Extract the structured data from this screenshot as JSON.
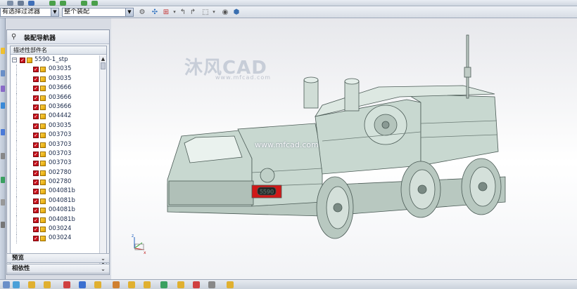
{
  "toolbar": {
    "filter_value": "有选择过滤器",
    "scope_value": "整个装配"
  },
  "navigator": {
    "title": "装配导航器",
    "column_header": "描述性部件名",
    "root_label": "5590-1_stp",
    "items": [
      "003035",
      "003035",
      "003666",
      "003666",
      "003666",
      "004442",
      "003035",
      "003703",
      "003703",
      "003703",
      "003703",
      "002780",
      "002780",
      "004081b",
      "004081b",
      "004081b",
      "004081b",
      "003024",
      "003024"
    ],
    "preview_label": "预览",
    "dependency_label": "相依性"
  },
  "viewport": {
    "watermark_text": "沐风CAD",
    "watermark_url": "www.mfcad.com",
    "watermark_center": "www.mfcad.com",
    "plate_text": "5590"
  },
  "colors": {
    "checkbox": "#c8101a",
    "part_cube": "#f0b800",
    "model_body": "#c8d8d0",
    "model_edges": "#4a5a55",
    "plate": "#d01818"
  }
}
